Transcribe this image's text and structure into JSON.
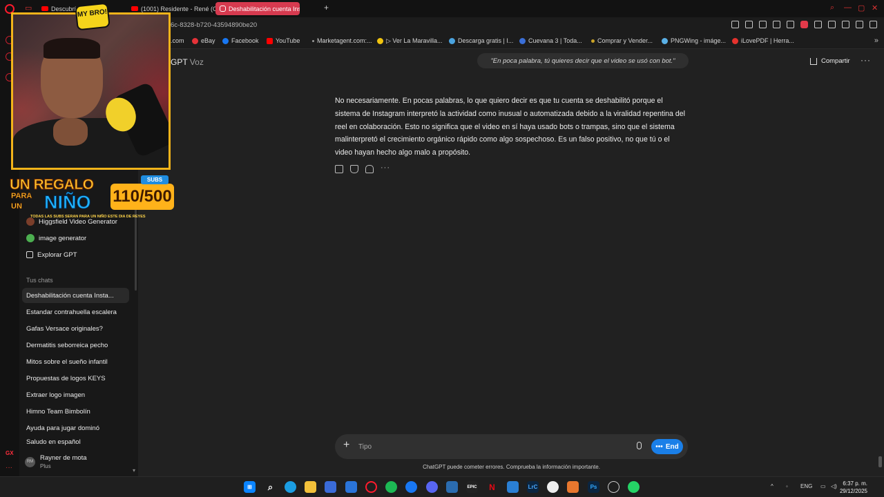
{
  "browser": {
    "tabs": [
      {
        "label": "Descubrí l... COLEC"
      },
      {
        "label": "(1001) Residente - René (C"
      },
      {
        "label": "Deshabilitación cuenta Ins"
      }
    ],
    "url_fragment": "6c-8328-b720-43594890be20",
    "bookmarks": [
      {
        "label": ".com"
      },
      {
        "label": "eBay"
      },
      {
        "label": "Facebook"
      },
      {
        "label": "YouTube"
      },
      {
        "label": "Marketagent.com:..."
      },
      {
        "label": "▷ Ver La Maravilla..."
      },
      {
        "label": "Descarga gratis | I..."
      },
      {
        "label": "Cuevana 3 | Toda..."
      },
      {
        "label": "Comprar y Vender..."
      },
      {
        "label": "PNGWing - imáge..."
      },
      {
        "label": "iLovePDF | Herra..."
      }
    ]
  },
  "sidebar": {
    "gpts": [
      {
        "label": "Higgsfield Video Generator",
        "icon": "higgsfield-icon"
      },
      {
        "label": "image generator",
        "icon": "image-generator-icon"
      },
      {
        "label": "Explorar GPT",
        "icon": "explore-icon"
      }
    ],
    "section_title": "Tus chats",
    "chats": [
      "Deshabilitación cuenta Insta...",
      "Estandar contrahuella escalera",
      "Gafas Versace originales?",
      "Dermatitis seborreica pecho",
      "Mitos sobre el sueño infantil",
      "Propuestas de logos KEYS",
      "Extraer logo imagen",
      "Himno Team Bimbolín",
      "Ayuda para jugar dominó",
      "Saludo en español"
    ],
    "user": {
      "name": "Rayner de mota",
      "plan": "Plus",
      "initials": "RM"
    }
  },
  "main": {
    "model_title": "GPT",
    "model_mode": "Voz",
    "voice_transcript": "\"En poca palabra, tú quieres decir que el video se usó con bot.\"",
    "share_label": "Compartir",
    "assistant_message": "No necesariamente. En pocas palabras, lo que quiero decir es que tu cuenta se deshabilitó porque el sistema de Instagram interpretó la actividad como inusual o automatizada debido a la viralidad repentina del reel en colaboración. Esto no significa que el video en sí haya usado bots o trampas, sino que el sistema malinterpretó el crecimiento orgánico rápido como algo sospechoso. Es un falso positivo, no que tú o el video hayan hecho algo malo a propósito.",
    "composer_placeholder": "Tipo",
    "end_label": "End",
    "disclaimer": "ChatGPT puede cometer errores. Comprueba la información importante."
  },
  "overlay": {
    "sticker": "MY BRO!",
    "promo_line1": "UN REGALO",
    "promo_para": "PARA",
    "promo_un": "UN",
    "promo_nino": "NIÑO",
    "promo_count": "110/500",
    "promo_subs": "SUBS",
    "promo_small": "TODAS LAS SUBS SERAN PARA UN NIÑO ESTE DIA DE REYES"
  },
  "taskbar": {
    "lang": "ENG",
    "time": "6:37 p. m.",
    "date": "29/12/2025"
  },
  "colors": {
    "accent_blue": "#1a7fe8",
    "opera_red": "#ff1b2d",
    "active_tab": "#d63a4f",
    "promo_yellow": "#ffc82e",
    "promo_blue": "#1fb3ff"
  }
}
